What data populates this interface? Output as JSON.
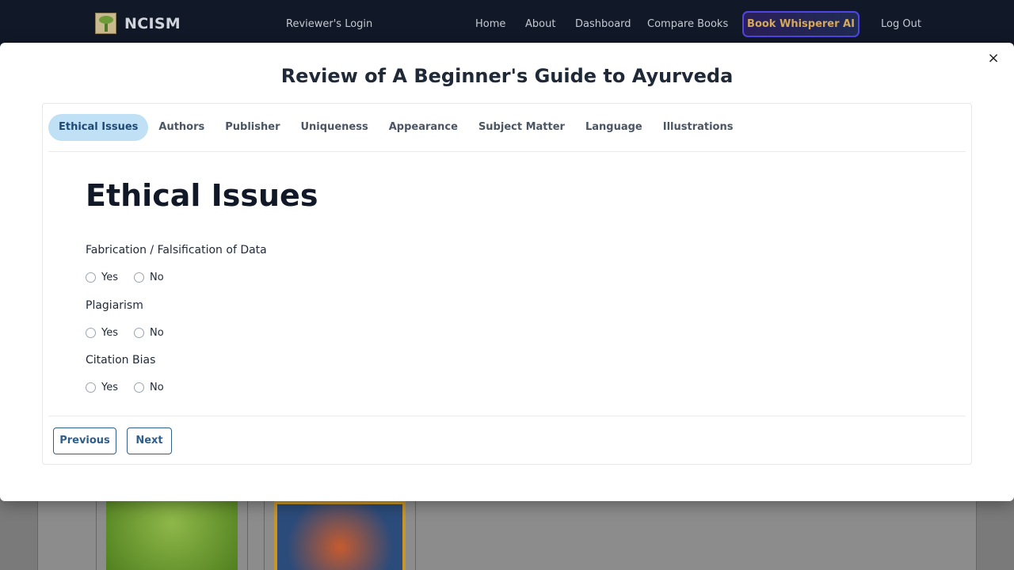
{
  "nav": {
    "brand": "NCISM",
    "reviewer_login": "Reviewer's Login",
    "home": "Home",
    "about": "About",
    "dashboard": "Dashboard",
    "compare": "Compare Books",
    "ai_button": "Book Whisperer AI",
    "logout": "Log Out"
  },
  "modal": {
    "close": "×",
    "title": "Review of A Beginner's Guide to Ayurveda",
    "tabs": [
      "Ethical Issues",
      "Authors",
      "Publisher",
      "Uniqueness",
      "Appearance",
      "Subject Matter",
      "Language",
      "Illustrations"
    ],
    "active_tab": "Ethical Issues",
    "section_title": "Ethical Issues",
    "questions": [
      {
        "label": "Fabrication / Falsification of Data",
        "options": [
          "Yes",
          "No"
        ],
        "selected": null
      },
      {
        "label": "Plagiarism",
        "options": [
          "Yes",
          "No"
        ],
        "selected": null
      },
      {
        "label": "Citation Bias",
        "options": [
          "Yes",
          "No"
        ],
        "selected": null
      }
    ],
    "previous": "Previous",
    "next": "Next"
  },
  "colors": {
    "navbar": "#111827",
    "active_tab_bg": "#bfe0f5",
    "button_accent": "#2f5f8a",
    "ai_border": "#4f46e5",
    "ai_text": "#d6a85a"
  }
}
